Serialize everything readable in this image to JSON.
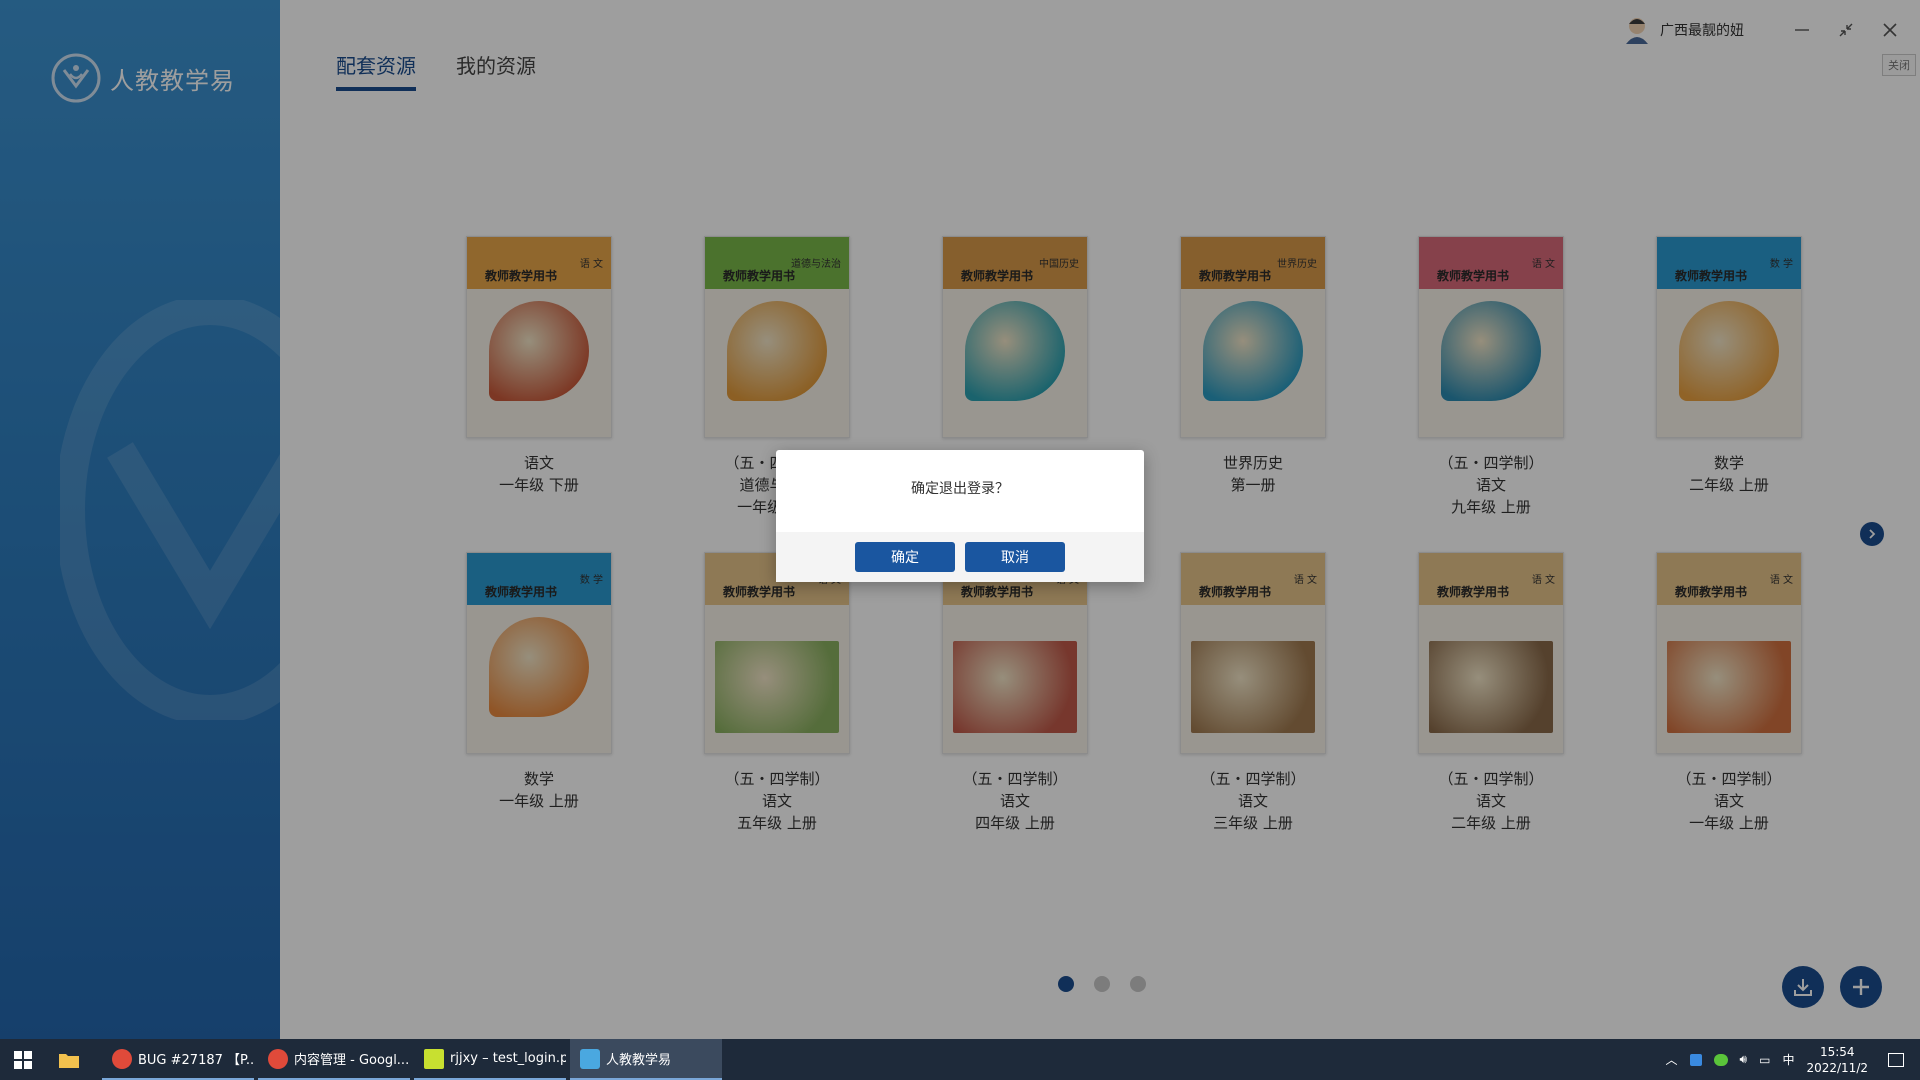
{
  "app": {
    "name": "人教教学易",
    "tabs": [
      {
        "label": "配套资源",
        "active": true
      },
      {
        "label": "我的资源",
        "active": false
      }
    ],
    "user_name": "广西最靓的妞",
    "close_tip": "关闭",
    "accent": "#1a4d8f"
  },
  "books": [
    {
      "title_line1": "语文",
      "title_line2": "一年级  下册",
      "title_line3": "",
      "subject": "语 文",
      "band_color": "#e8a64a",
      "pic_color": "#c95a3b"
    },
    {
      "title_line1": "（五・四学制）",
      "title_line2": "道德与法治",
      "title_line3": "一年级  上册",
      "subject": "道德与法治",
      "band_color": "#7ab84a",
      "pic_color": "#e29a3a"
    },
    {
      "title_line1": "",
      "title_line2": "",
      "title_line3": "",
      "subject": "中国历史",
      "band_color": "#d99a4a",
      "pic_color": "#2aa0b0"
    },
    {
      "title_line1": "世界历史",
      "title_line2": "第一册",
      "title_line3": "",
      "subject": "世界历史",
      "band_color": "#d99a4a",
      "pic_color": "#2a9ac0"
    },
    {
      "title_line1": "（五・四学制）",
      "title_line2": "语文",
      "title_line3": "九年级  上册",
      "subject": "语 文",
      "band_color": "#d86a7a",
      "pic_color": "#2a8ab0"
    },
    {
      "title_line1": "数学",
      "title_line2": "二年级  上册",
      "title_line3": "",
      "subject": "数 学",
      "band_color": "#2a9ad0",
      "pic_color": "#e8a040"
    },
    {
      "title_line1": "数学",
      "title_line2": "一年级  上册",
      "title_line3": "",
      "subject": "数 学",
      "band_color": "#2a9ad0",
      "pic_color": "#e88a40"
    },
    {
      "title_line1": "（五・四学制）",
      "title_line2": "语文",
      "title_line3": "五年级  上册",
      "subject": "语 文",
      "band_color": "#e6c48a",
      "pic_color": "#8ab060"
    },
    {
      "title_line1": "（五・四学制）",
      "title_line2": "语文",
      "title_line3": "四年级  上册",
      "subject": "语 文",
      "band_color": "#e6c48a",
      "pic_color": "#c05a4a"
    },
    {
      "title_line1": "（五・四学制）",
      "title_line2": "语文",
      "title_line3": "三年级  上册",
      "subject": "语 文",
      "band_color": "#e6c48a",
      "pic_color": "#a07a50"
    },
    {
      "title_line1": "（五・四学制）",
      "title_line2": "语文",
      "title_line3": "二年级  上册",
      "subject": "语 文",
      "band_color": "#e6c48a",
      "pic_color": "#8a6a4a"
    },
    {
      "title_line1": "（五・四学制）",
      "title_line2": "语文",
      "title_line3": "一年级  上册",
      "subject": "语 文",
      "band_color": "#e6c48a",
      "pic_color": "#d07040"
    }
  ],
  "cover_header": "教师教学用书",
  "pagination": {
    "pages": 3,
    "current": 1
  },
  "dialog": {
    "message": "确定退出登录？",
    "confirm": "确定",
    "cancel": "取消"
  },
  "taskbar": {
    "items": [
      {
        "label": "BUG #27187 【P...",
        "icon_color": "#e04a3a",
        "active": false
      },
      {
        "label": "内容管理 - Googl...",
        "icon_color": "#e04a3a",
        "active": false
      },
      {
        "label": "rjjxy – test_login.p...",
        "icon_color": "#c8e030",
        "active": false
      },
      {
        "label": "人教教学易",
        "icon_color": "#4aa8e0",
        "active": true
      }
    ],
    "ime": "中",
    "time": "15:54",
    "date": "2022/11/2"
  }
}
